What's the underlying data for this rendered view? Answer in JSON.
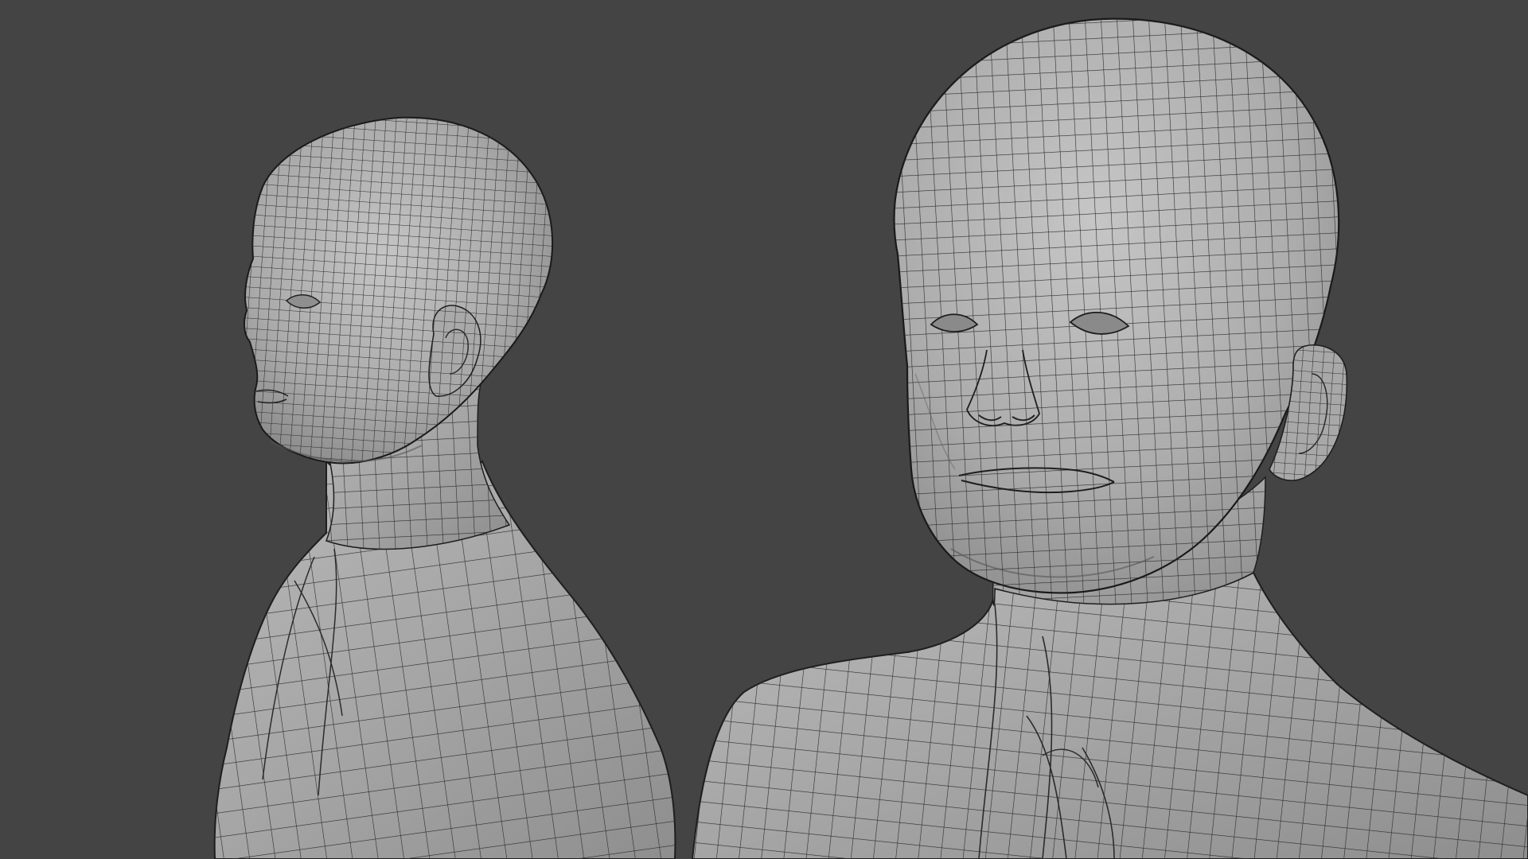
{
  "scene": {
    "background_color": "#444444",
    "mesh_fill_color": "#a7a7a7",
    "wire_color": "#2b2b2b",
    "shading": "solid-wireframe",
    "objects": [
      {
        "name": "left-bust",
        "view": "three-quarter-left"
      },
      {
        "name": "right-bust",
        "view": "front-close"
      }
    ]
  }
}
